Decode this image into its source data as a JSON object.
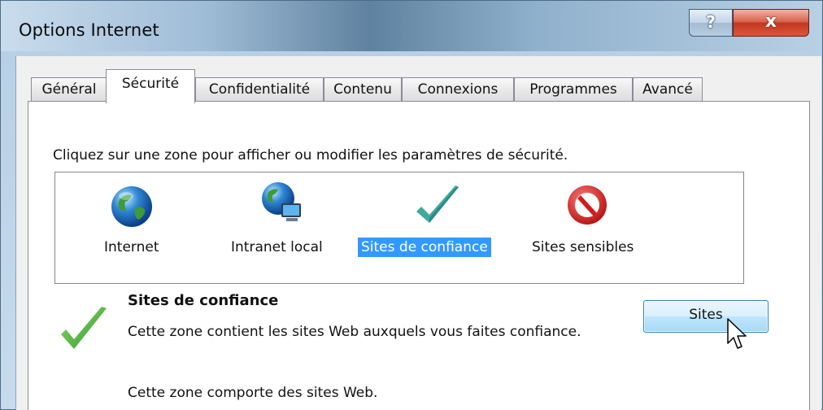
{
  "window": {
    "title": "Options Internet",
    "help_glyph": "?",
    "close_glyph": "x"
  },
  "tabs": [
    {
      "label": "Général",
      "active": false
    },
    {
      "label": "Sécurité",
      "active": true
    },
    {
      "label": "Confidentialité",
      "active": false
    },
    {
      "label": "Contenu",
      "active": false
    },
    {
      "label": "Connexions",
      "active": false
    },
    {
      "label": "Programmes",
      "active": false
    },
    {
      "label": "Avancé",
      "active": false
    }
  ],
  "security": {
    "instructions": "Cliquez sur une zone pour afficher ou modifier les paramètres de sécurité.",
    "zones": [
      {
        "label": "Internet",
        "icon": "globe-icon",
        "selected": false
      },
      {
        "label": "Intranet local",
        "icon": "globe-computer-icon",
        "selected": false
      },
      {
        "label": "Sites de confiance",
        "icon": "checkmark-icon",
        "selected": true
      },
      {
        "label": "Sites sensibles",
        "icon": "prohibited-icon",
        "selected": false
      }
    ],
    "selected_zone": {
      "title": "Sites de confiance",
      "description": "Cette zone contient les sites Web auxquels vous faites confiance.",
      "extra": "Cette zone comporte des sites Web.",
      "icon": "checkmark-icon"
    },
    "sites_button_label": "Sites"
  },
  "colors": {
    "selection": "#3399ff",
    "close_button": "#c3361e",
    "checkmark": "#3fa9a0"
  }
}
